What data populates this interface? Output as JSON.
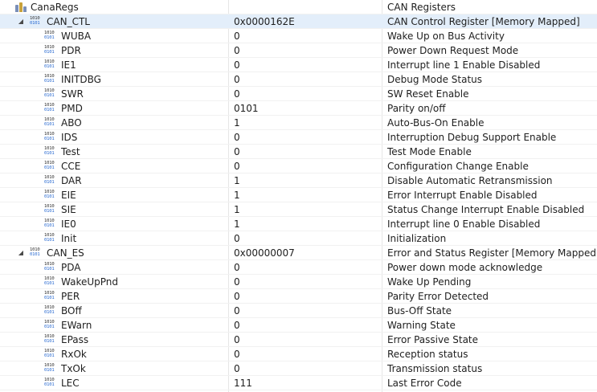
{
  "root": {
    "label": "CanaRegs",
    "description": "CAN Registers"
  },
  "groups": [
    {
      "name": "CAN_CTL",
      "value": "0x0000162E",
      "description": "CAN Control Register [Memory Mapped]",
      "fields": [
        {
          "name": "WUBA",
          "value": "0",
          "description": "Wake Up on Bus Activity"
        },
        {
          "name": "PDR",
          "value": "0",
          "description": "Power Down Request Mode"
        },
        {
          "name": "IE1",
          "value": "0",
          "description": "Interrupt line 1 Enable Disabled"
        },
        {
          "name": "INITDBG",
          "value": "0",
          "description": "Debug Mode Status"
        },
        {
          "name": "SWR",
          "value": "0",
          "description": "SW Reset Enable"
        },
        {
          "name": "PMD",
          "value": "0101",
          "description": "Parity on/off"
        },
        {
          "name": "ABO",
          "value": "1",
          "description": "Auto-Bus-On Enable"
        },
        {
          "name": "IDS",
          "value": "0",
          "description": "Interruption Debug Support Enable"
        },
        {
          "name": "Test",
          "value": "0",
          "description": "Test Mode Enable"
        },
        {
          "name": "CCE",
          "value": "0",
          "description": "Configuration Change Enable"
        },
        {
          "name": "DAR",
          "value": "1",
          "description": "Disable Automatic Retransmission"
        },
        {
          "name": "EIE",
          "value": "1",
          "description": "Error Interrupt Enable Disabled"
        },
        {
          "name": "SIE",
          "value": "1",
          "description": "Status Change Interrupt Enable Disabled"
        },
        {
          "name": "IE0",
          "value": "1",
          "description": "Interrupt line 0 Enable Disabled"
        },
        {
          "name": "Init",
          "value": "0",
          "description": "Initialization"
        }
      ]
    },
    {
      "name": "CAN_ES",
      "value": "0x00000007",
      "description": "Error and Status Register [Memory Mapped]",
      "fields": [
        {
          "name": "PDA",
          "value": "0",
          "description": "Power down mode acknowledge"
        },
        {
          "name": "WakeUpPnd",
          "value": "0",
          "description": "Wake Up Pending"
        },
        {
          "name": "PER",
          "value": "0",
          "description": "Parity Error Detected"
        },
        {
          "name": "BOff",
          "value": "0",
          "description": "Bus-Off State"
        },
        {
          "name": "EWarn",
          "value": "0",
          "description": "Warning State"
        },
        {
          "name": "EPass",
          "value": "0",
          "description": "Error Passive State"
        },
        {
          "name": "RxOk",
          "value": "0",
          "description": "Reception status"
        },
        {
          "name": "TxOk",
          "value": "0",
          "description": "Transmission status"
        },
        {
          "name": "LEC",
          "value": "111",
          "description": "Last Error Code"
        }
      ]
    }
  ],
  "icons": {
    "root": "register-bank-icon",
    "register": "binary-register-icon",
    "field": "binary-field-icon",
    "expanded": "expanded-triangle-icon"
  },
  "colors": {
    "selected_row": "#e3eefa",
    "grid": "#e6e6e6",
    "icon_accent": "#2a6bd1"
  }
}
